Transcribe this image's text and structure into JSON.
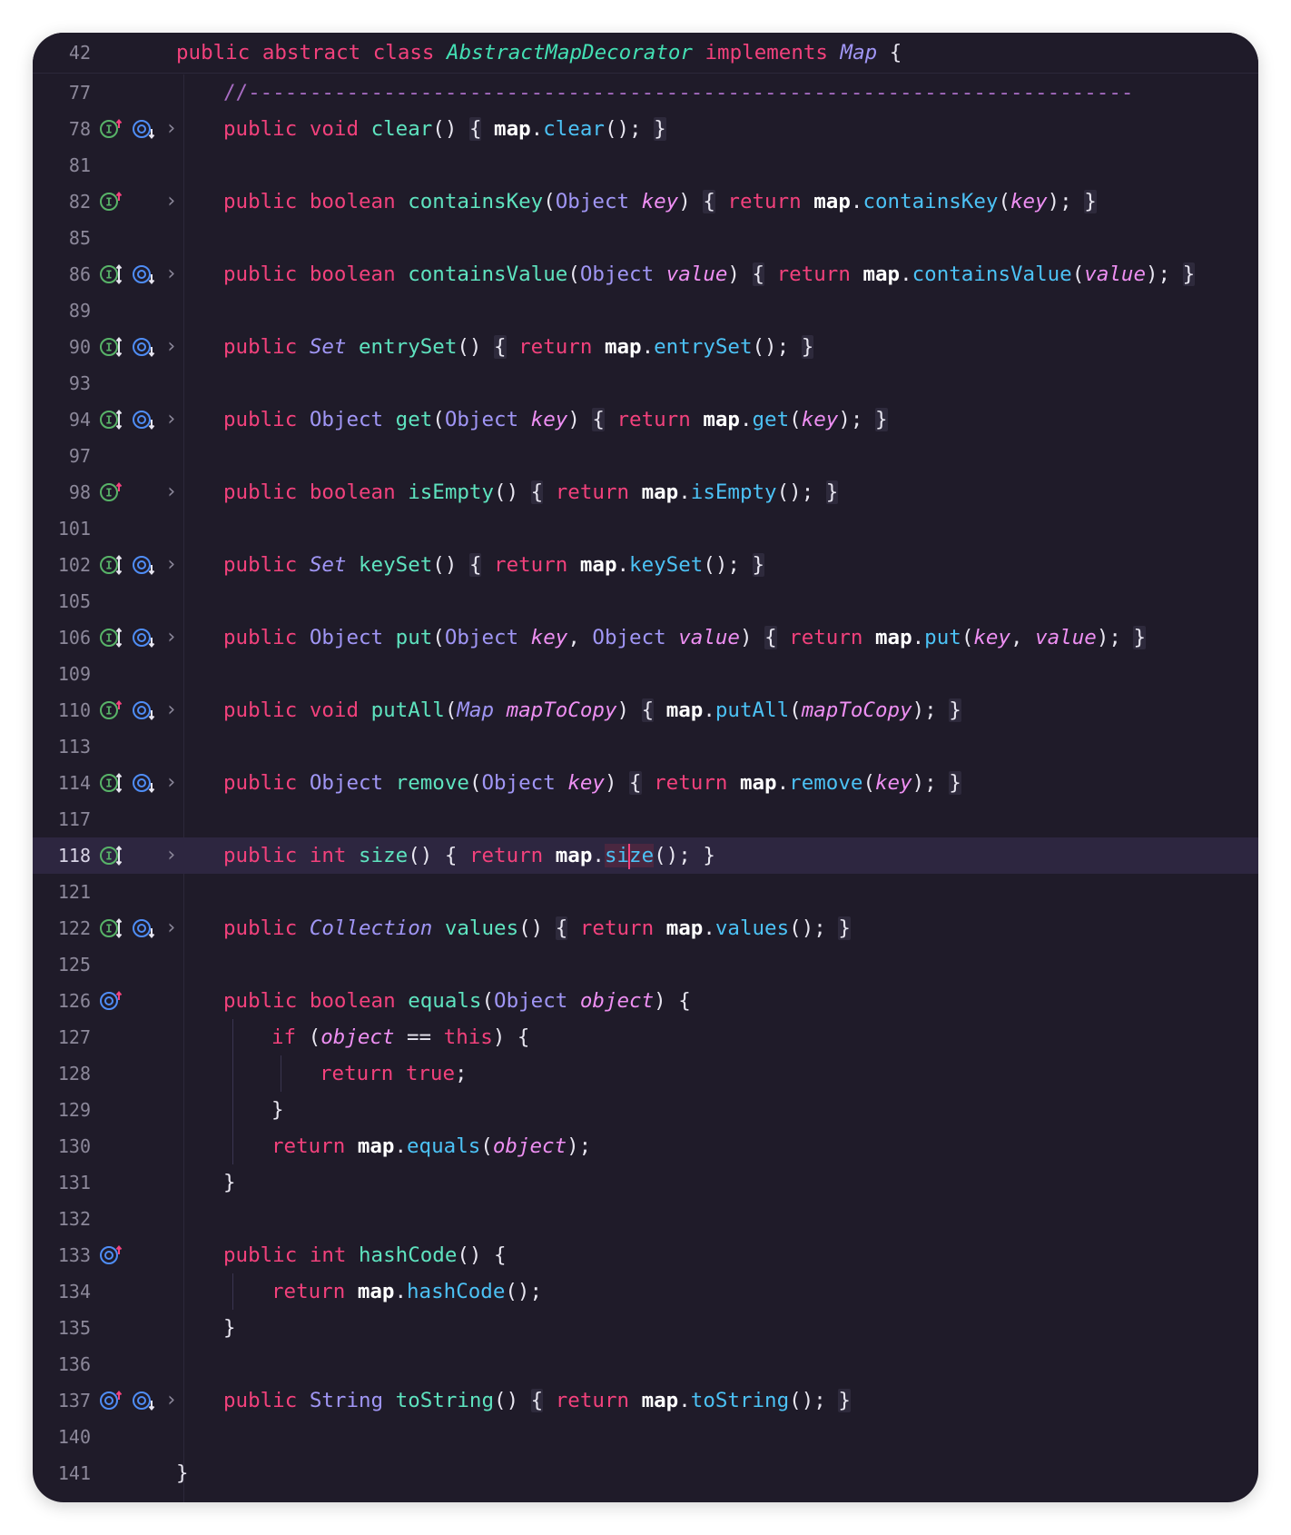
{
  "editor": {
    "sticky_line": {
      "number": "42",
      "code": "public abstract class AbstractMapDecorator implements Map {"
    },
    "lines": [
      {
        "number": "77",
        "code": "//------------------------------------------------------------------------"
      },
      {
        "number": "78",
        "code": "public void clear() { map.clear(); }"
      },
      {
        "number": "81",
        "code": ""
      },
      {
        "number": "82",
        "code": "public boolean containsKey(Object key) { return map.containsKey(key); }"
      },
      {
        "number": "85",
        "code": ""
      },
      {
        "number": "86",
        "code": "public boolean containsValue(Object value) { return map.containsValue(value); }"
      },
      {
        "number": "89",
        "code": ""
      },
      {
        "number": "90",
        "code": "public Set entrySet() { return map.entrySet(); }"
      },
      {
        "number": "93",
        "code": ""
      },
      {
        "number": "94",
        "code": "public Object get(Object key) { return map.get(key); }"
      },
      {
        "number": "97",
        "code": ""
      },
      {
        "number": "98",
        "code": "public boolean isEmpty() { return map.isEmpty(); }"
      },
      {
        "number": "101",
        "code": ""
      },
      {
        "number": "102",
        "code": "public Set keySet() { return map.keySet(); }"
      },
      {
        "number": "105",
        "code": ""
      },
      {
        "number": "106",
        "code": "public Object put(Object key, Object value) { return map.put(key, value); }"
      },
      {
        "number": "109",
        "code": ""
      },
      {
        "number": "110",
        "code": "public void putAll(Map mapToCopy) { map.putAll(mapToCopy); }"
      },
      {
        "number": "113",
        "code": ""
      },
      {
        "number": "114",
        "code": "public Object remove(Object key) { return map.remove(key); }"
      },
      {
        "number": "117",
        "code": ""
      },
      {
        "number": "118",
        "code": "public int size() { return map.size(); }"
      },
      {
        "number": "121",
        "code": ""
      },
      {
        "number": "122",
        "code": "public Collection values() { return map.values(); }"
      },
      {
        "number": "125",
        "code": ""
      },
      {
        "number": "126",
        "code": "public boolean equals(Object object) {"
      },
      {
        "number": "127",
        "code": "if (object == this) {"
      },
      {
        "number": "128",
        "code": "return true;"
      },
      {
        "number": "129",
        "code": "}"
      },
      {
        "number": "130",
        "code": "return map.equals(object);"
      },
      {
        "number": "131",
        "code": "}"
      },
      {
        "number": "132",
        "code": ""
      },
      {
        "number": "133",
        "code": "public int hashCode() {"
      },
      {
        "number": "134",
        "code": "return map.hashCode();"
      },
      {
        "number": "135",
        "code": "}"
      },
      {
        "number": "136",
        "code": ""
      },
      {
        "number": "137",
        "code": "public String toString() { return map.toString(); }"
      },
      {
        "number": "140",
        "code": ""
      },
      {
        "number": "141",
        "code": "}"
      }
    ],
    "current_line": "118"
  },
  "colors": {
    "background": "#1f1b29",
    "keyword": "#f2417c",
    "type": "#a096f5",
    "class_name": "#43e0b4",
    "method_declaration": "#5ee3bf",
    "method_call": "#4cc2f5",
    "parameter": "#ee8ff2",
    "field": "#ffffff",
    "comment": "#a86cc3",
    "line_number": "#8c889a",
    "current_line_bg": "#2d2640",
    "implements_icon": "#58b368",
    "overrides_icon": "#4f8df5",
    "gutter_arrow_up": "#f2417c"
  },
  "icons": {
    "implements_up": "implements-interface-up-icon",
    "implements_updown": "implements-interface-updown-icon",
    "overridden_down": "overridden-down-icon",
    "overrides_up": "overrides-method-up-icon",
    "fold": "chevron-right-fold-icon"
  }
}
